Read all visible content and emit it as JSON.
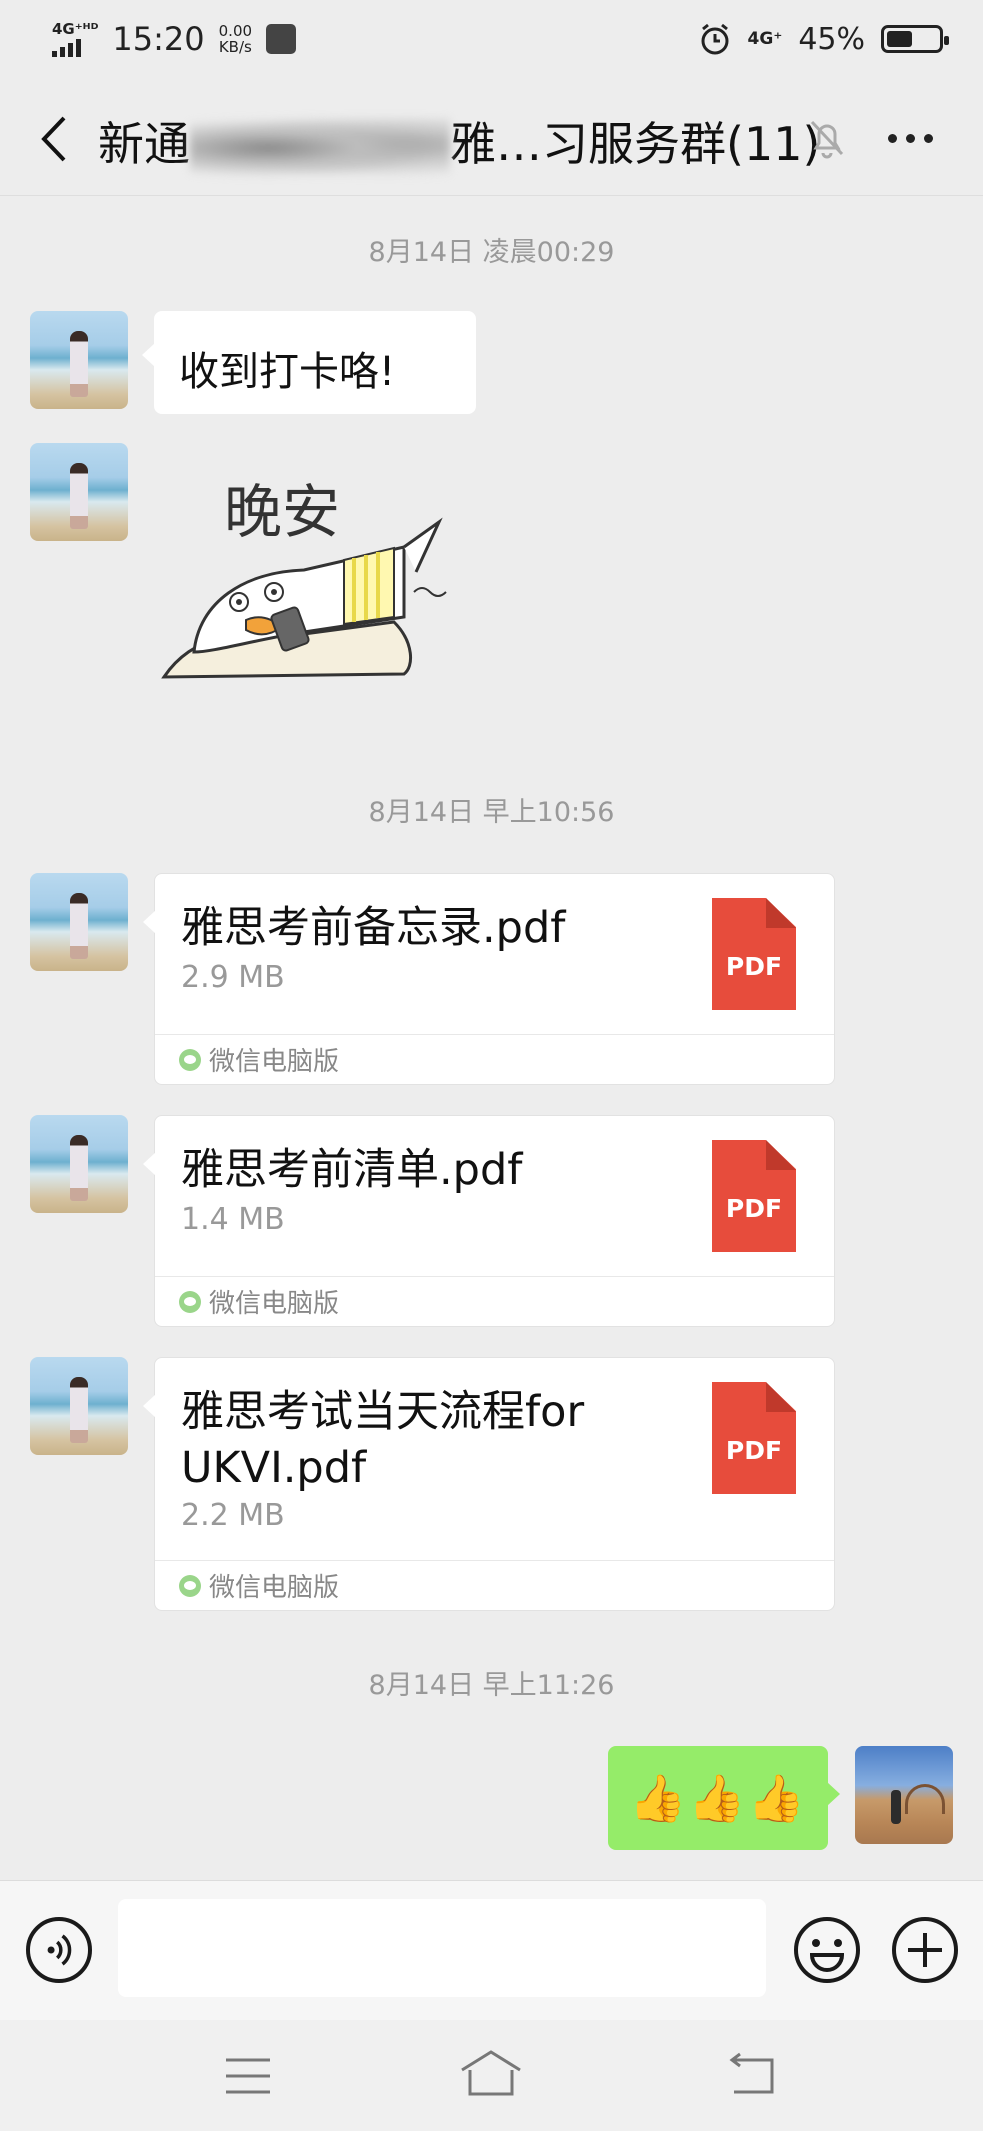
{
  "status_bar": {
    "network_type": "4G⁺ᴴᴰ",
    "time": "15:20",
    "speed_value": "0.00",
    "speed_unit": "KB/s",
    "network_right": "4G⁺",
    "battery_text": "45%",
    "battery_level": 0.45
  },
  "header": {
    "title_start": "新通",
    "title_mid": "雅",
    "title_end": "…习服务群(11)",
    "back_icon": "chevron-left-icon",
    "mute_icon": "bell-off-icon",
    "more_icon": "more-dots-icon"
  },
  "messages": [
    {
      "type": "timestamp",
      "text": "8月14日 凌晨00:29"
    },
    {
      "type": "text",
      "sender": "other",
      "text": "收到打卡咯!"
    },
    {
      "type": "sticker",
      "sender": "other",
      "text": "晚安"
    },
    {
      "type": "timestamp",
      "text": "8月14日 早上10:56"
    },
    {
      "type": "file",
      "sender": "other",
      "name": "雅思考前备忘录.pdf",
      "size": "2.9 MB",
      "icon_label": "PDF",
      "source": "微信电脑版"
    },
    {
      "type": "file",
      "sender": "other",
      "name": "雅思考前清单.pdf",
      "size": "1.4 MB",
      "icon_label": "PDF",
      "source": "微信电脑版"
    },
    {
      "type": "file",
      "sender": "other",
      "name": "雅思考试当天流程forUKVI.pdf",
      "size": "2.2 MB",
      "icon_label": "PDF",
      "source": "微信电脑版"
    },
    {
      "type": "timestamp",
      "text": "8月14日 早上11:26"
    },
    {
      "type": "text",
      "sender": "me",
      "text": "👍👍👍"
    }
  ],
  "input_bar": {
    "voice_icon": "voice-icon",
    "emoji_icon": "emoji-icon",
    "plus_icon": "plus-icon",
    "placeholder": ""
  },
  "nav_bar": {
    "menu_icon": "menu-icon",
    "home_icon": "home-icon",
    "back_icon": "back-icon"
  },
  "colors": {
    "background": "#ededed",
    "my_bubble": "#95ec69",
    "pdf_red": "#e74c3c"
  }
}
